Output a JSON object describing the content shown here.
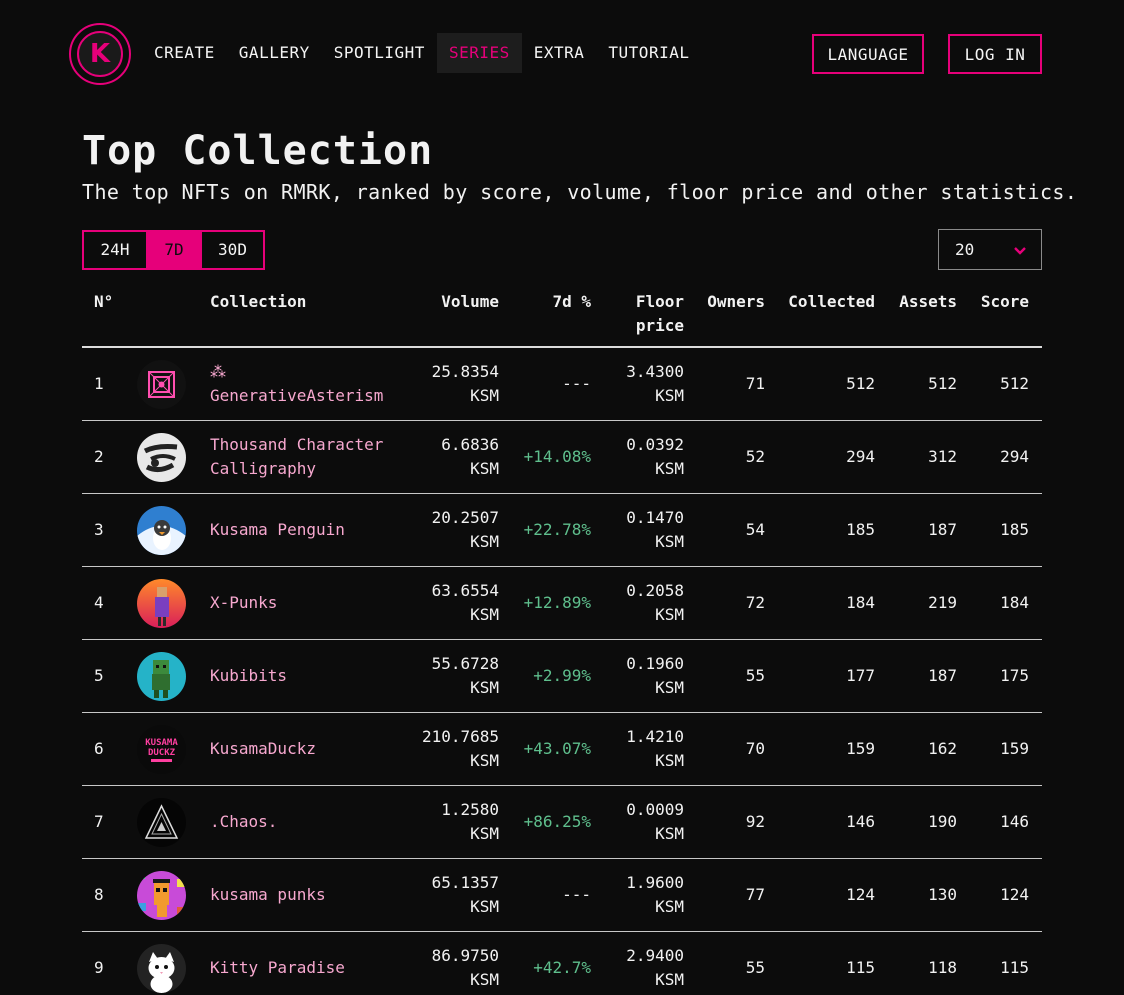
{
  "header": {
    "nav": [
      "CREATE",
      "GALLERY",
      "SPOTLIGHT",
      "SERIES",
      "EXTRA",
      "TUTORIAL"
    ],
    "active_nav": "SERIES",
    "language_label": "LANGUAGE",
    "login_label": "LOG IN",
    "logo_letter": "K"
  },
  "page": {
    "title": "Top Collection",
    "subtitle": "The top NFTs on RMRK, ranked by score, volume, floor price and other statistics."
  },
  "controls": {
    "periods": [
      "24H",
      "7D",
      "30D"
    ],
    "active_period": "7D",
    "page_size": "20"
  },
  "table": {
    "headers": {
      "num": "N°",
      "collection": "Collection",
      "volume": "Volume",
      "change": "7d %",
      "floor_1": "Floor",
      "floor_2": "price",
      "owners": "Owners",
      "collected": "Collected",
      "assets": "Assets",
      "score": "Score"
    },
    "currency": "KSM",
    "rows": [
      {
        "n": "1",
        "name1": "⁂",
        "name2": "GenerativeAsterism",
        "volume": "25.8354",
        "change": "---",
        "floor": "3.4300",
        "owners": "71",
        "collected": "512",
        "assets": "512",
        "score": "512",
        "avatar": "asterism"
      },
      {
        "n": "2",
        "name1": "Thousand Character",
        "name2": "Calligraphy",
        "volume": "6.6836",
        "change": "+14.08%",
        "floor": "0.0392",
        "owners": "52",
        "collected": "294",
        "assets": "312",
        "score": "294",
        "avatar": "calligraphy"
      },
      {
        "n": "3",
        "name1": "Kusama Penguin",
        "name2": "",
        "volume": "20.2507",
        "change": "+22.78%",
        "floor": "0.1470",
        "owners": "54",
        "collected": "185",
        "assets": "187",
        "score": "185",
        "avatar": "penguin"
      },
      {
        "n": "4",
        "name1": "X-Punks",
        "name2": "",
        "volume": "63.6554",
        "change": "+12.89%",
        "floor": "0.2058",
        "owners": "72",
        "collected": "184",
        "assets": "219",
        "score": "184",
        "avatar": "xpunks"
      },
      {
        "n": "5",
        "name1": "Kubibits",
        "name2": "",
        "volume": "55.6728",
        "change": "+2.99%",
        "floor": "0.1960",
        "owners": "55",
        "collected": "177",
        "assets": "187",
        "score": "175",
        "avatar": "kubibits"
      },
      {
        "n": "6",
        "name1": "KusamaDuckz",
        "name2": "",
        "volume": "210.7685",
        "change": "+43.07%",
        "floor": "1.4210",
        "owners": "70",
        "collected": "159",
        "assets": "162",
        "score": "159",
        "avatar": "duckz"
      },
      {
        "n": "7",
        "name1": ".Chaos.",
        "name2": "",
        "volume": "1.2580",
        "change": "+86.25%",
        "floor": "0.0009",
        "owners": "92",
        "collected": "146",
        "assets": "190",
        "score": "146",
        "avatar": "chaos"
      },
      {
        "n": "8",
        "name1": "kusama punks",
        "name2": "",
        "volume": "65.1357",
        "change": "---",
        "floor": "1.9600",
        "owners": "77",
        "collected": "124",
        "assets": "130",
        "score": "124",
        "avatar": "punks"
      },
      {
        "n": "9",
        "name1": "Kitty Paradise",
        "name2": "",
        "volume": "86.9750",
        "change": "+42.7%",
        "floor": "2.9400",
        "owners": "55",
        "collected": "115",
        "assets": "118",
        "score": "115",
        "avatar": "kitty"
      }
    ]
  },
  "avatar_logo_text": {
    "line1": "KUSAMA",
    "line2": "DUCKZ"
  },
  "colors": {
    "accent": "#e6007a",
    "positive": "#5fbf8d",
    "link": "#f7a8cf",
    "background": "#0c0c0c"
  }
}
